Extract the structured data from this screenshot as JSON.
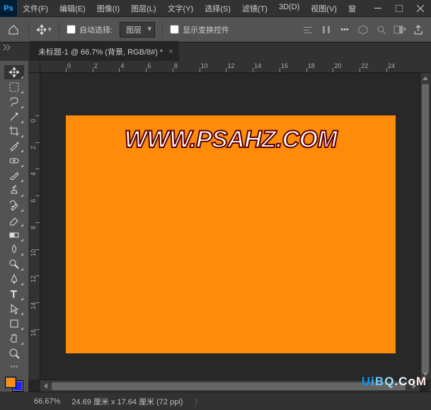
{
  "app": {
    "logo": "Ps"
  },
  "menu": {
    "file": "文件(F)",
    "edit": "编辑(E)",
    "image": "图像(I)",
    "layer": "图层(L)",
    "type": "文字(Y)",
    "select": "选择(S)",
    "filter": "滤镜(T)",
    "threeD": "3D(D)",
    "view": "视图(V)",
    "window": "窗"
  },
  "options": {
    "auto_select_label": "自动选择:",
    "target_dd": "图层",
    "show_transform_label": "显示变换控件"
  },
  "tab": {
    "title": "未标题-1 @ 66.7% (背景, RGB/8#) *"
  },
  "canvas": {
    "text": "WWW.PSAHZ.COM"
  },
  "ruler_h": [
    "0",
    "2",
    "4",
    "6",
    "8",
    "10",
    "12",
    "14",
    "16",
    "18",
    "20",
    "22",
    "24"
  ],
  "ruler_v": [
    "0",
    "2",
    "4",
    "6",
    "8",
    "10",
    "12",
    "14",
    "16"
  ],
  "colors": {
    "fg": "#ff8b0a",
    "bg": "#1924ff"
  },
  "status": {
    "zoom": "66.67%",
    "doc": "24.69 厘米 x 17.64 厘米 (72 ppi)"
  },
  "tools": [
    "move-tool",
    "marquee-tool",
    "lasso-tool",
    "magic-wand-tool",
    "crop-tool",
    "eyedropper-tool",
    "healing-brush-tool",
    "brush-tool",
    "clone-stamp-tool",
    "history-brush-tool",
    "eraser-tool",
    "gradient-tool",
    "blur-tool",
    "dodge-tool",
    "pen-tool",
    "type-tool",
    "path-select-tool",
    "shape-tool",
    "hand-tool",
    "zoom-tool"
  ],
  "watermark": "UiBQ.CoM"
}
